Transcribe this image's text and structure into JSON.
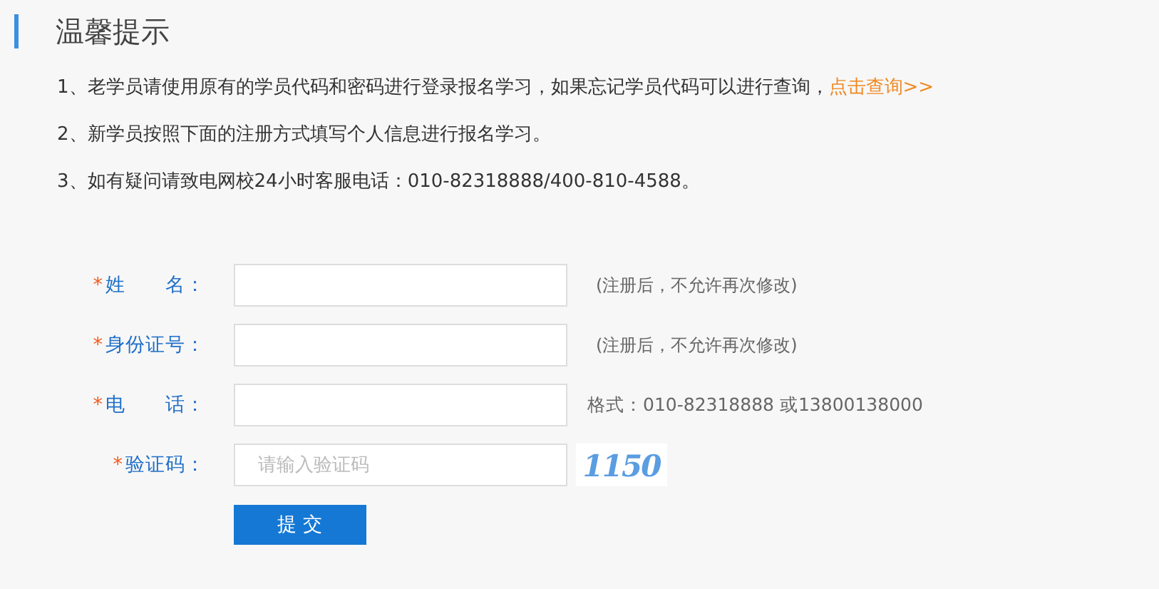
{
  "heading": "温馨提示",
  "notices": [
    {
      "text": "1、老学员请使用原有的学员代码和密码进行登录报名学习，如果忘记学员代码可以进行查询，",
      "link": "点击查询>>"
    },
    {
      "text": "2、新学员按照下面的注册方式填写个人信息进行报名学习。"
    },
    {
      "text": "3、如有疑问请致电网校24小时客服电话：010-82318888/400-810-4588。"
    }
  ],
  "form": [
    {
      "kind": "text",
      "required_mark": "*",
      "label": "姓　　名：",
      "hint": "(注册后，不允许再次修改)"
    },
    {
      "kind": "text",
      "required_mark": "*",
      "label": "身份证号：",
      "hint": "(注册后，不允许再次修改)"
    },
    {
      "kind": "text",
      "required_mark": "*",
      "label": "电　　话：",
      "hint": "格式：010-82318888 或13800138000"
    },
    {
      "kind": "captcha",
      "required_mark": "*",
      "label": "验证码：",
      "placeholder": "请输入验证码",
      "captcha": "1150"
    }
  ],
  "submit": "提 交"
}
